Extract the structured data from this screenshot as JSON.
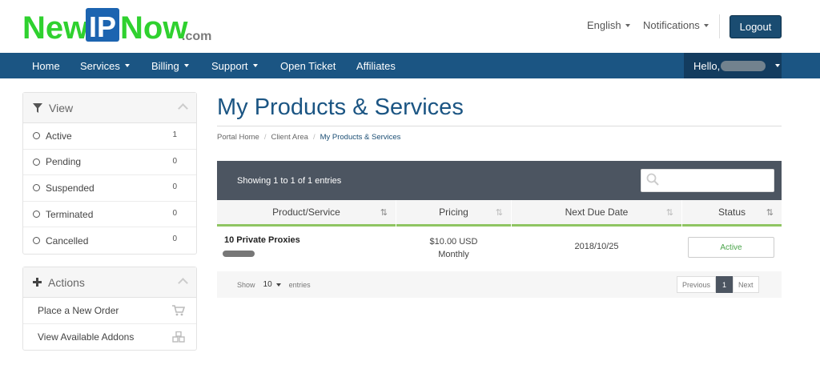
{
  "brand": {
    "logo_new": "New",
    "logo_ip": "IP",
    "logo_now": "Now",
    "logo_dotcom": ".com",
    "colors": {
      "green": "#2fd12f",
      "blue": "#1c64b0",
      "navy": "#1b5583"
    }
  },
  "topbar": {
    "language": "English",
    "notifications": "Notifications",
    "logout": "Logout"
  },
  "nav": {
    "items": [
      {
        "label": "Home",
        "dropdown": false
      },
      {
        "label": "Services",
        "dropdown": true
      },
      {
        "label": "Billing",
        "dropdown": true
      },
      {
        "label": "Support",
        "dropdown": true
      },
      {
        "label": "Open Ticket",
        "dropdown": false
      },
      {
        "label": "Affiliates",
        "dropdown": false
      }
    ],
    "hello": "Hello,"
  },
  "sidebar": {
    "view": {
      "title": "View",
      "items": [
        {
          "label": "Active",
          "count": "1"
        },
        {
          "label": "Pending",
          "count": "0"
        },
        {
          "label": "Suspended",
          "count": "0"
        },
        {
          "label": "Terminated",
          "count": "0"
        },
        {
          "label": "Cancelled",
          "count": "0"
        }
      ]
    },
    "actions": {
      "title": "Actions",
      "items": [
        {
          "label": "Place a New Order",
          "icon": "cart-icon"
        },
        {
          "label": "View Available Addons",
          "icon": "cubes-icon"
        }
      ]
    }
  },
  "main": {
    "title": "My Products & Services",
    "breadcrumb": [
      "Portal Home",
      "Client Area",
      "My Products & Services"
    ],
    "table": {
      "showing": "Showing 1 to 1 of 1 entries",
      "columns": [
        "Product/Service",
        "Pricing",
        "Next Due Date",
        "Status"
      ],
      "rows": [
        {
          "product": "10 Private Proxies",
          "price": "$10.00 USD",
          "cycle": "Monthly",
          "due": "2018/10/25",
          "status": "Active"
        }
      ],
      "footer": {
        "show": "Show",
        "page_size": "10",
        "entries": "entries",
        "previous": "Previous",
        "page": "1",
        "next": "Next"
      }
    }
  }
}
